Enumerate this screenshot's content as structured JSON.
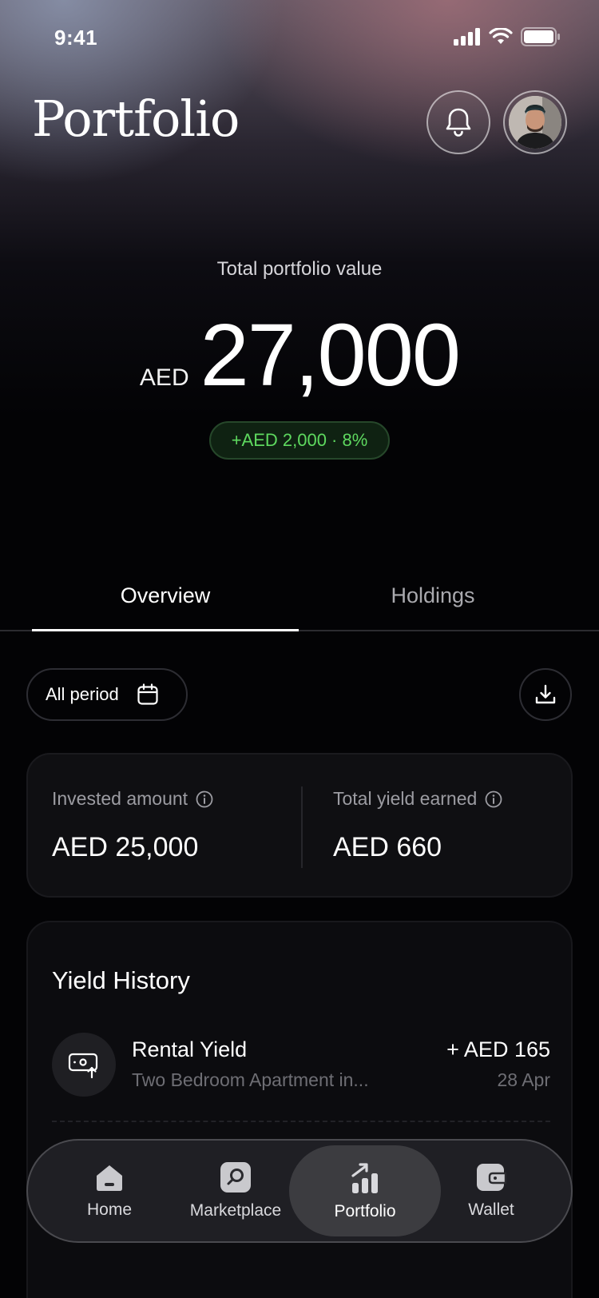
{
  "status_bar": {
    "time": "9:41"
  },
  "header": {
    "title": "Portfolio"
  },
  "portfolio": {
    "total_label": "Total portfolio value",
    "currency": "AED",
    "amount": "27,000",
    "change": "+AED 2,000 · 8%"
  },
  "tabs": [
    {
      "label": "Overview",
      "active": true
    },
    {
      "label": "Holdings",
      "active": false
    }
  ],
  "filters": {
    "period_label": "All period"
  },
  "stats": {
    "invested_label": "Invested amount",
    "invested_value": "AED 25,000",
    "yield_label": "Total yield earned",
    "yield_value": "AED 660"
  },
  "yield_history": {
    "title": "Yield History",
    "items": [
      {
        "title": "Rental Yield",
        "subtitle": "Two Bedroom Apartment in...",
        "amount": "+ AED 165",
        "date": "28 Apr"
      }
    ]
  },
  "bottom_nav": {
    "items": [
      {
        "label": "Home",
        "icon": "home-icon"
      },
      {
        "label": "Marketplace",
        "icon": "marketplace-icon"
      },
      {
        "label": "Portfolio",
        "icon": "portfolio-icon",
        "active": true
      },
      {
        "label": "Wallet",
        "icon": "wallet-icon"
      }
    ]
  },
  "colors": {
    "accent_green": "#5ed95f",
    "background": "#030305",
    "card": "#0f0f12"
  }
}
